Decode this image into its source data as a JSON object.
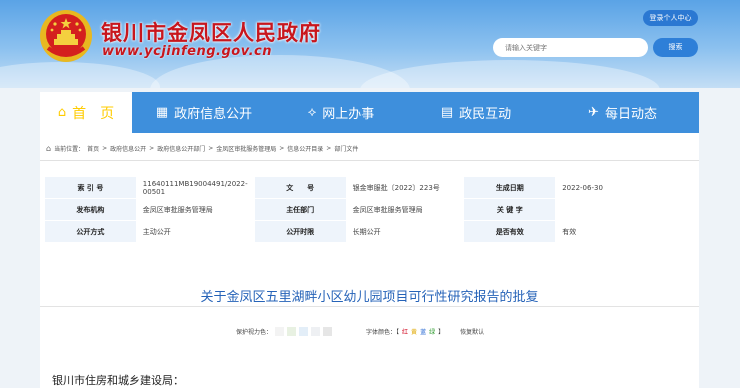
{
  "header": {
    "site_name": "银川市金凤区人民政府",
    "site_url": "www.ycjinfeng.gov.cn",
    "login_label": "登录个人中心",
    "search_placeholder": "请输入关键字",
    "search_button": "搜索"
  },
  "nav": {
    "items": [
      {
        "label": "首　页",
        "icon": "home-icon"
      },
      {
        "label": "政府信息公开",
        "icon": "building-icon"
      },
      {
        "label": "网上办事",
        "icon": "handshake-icon"
      },
      {
        "label": "政民互动",
        "icon": "chat-icon"
      },
      {
        "label": "每日动态",
        "icon": "megaphone-icon"
      }
    ]
  },
  "breadcrumb": {
    "prefix": "当前位置：",
    "items": [
      "首页",
      "政府信息公开",
      "政府信息公开部门",
      "金凤区审批服务管理局",
      "信息公开目录",
      "部门文件"
    ]
  },
  "meta": {
    "index_label": "索 引 号",
    "index_value": "11640111MB19004491/2022-00501",
    "doc_no_label": "文　　号",
    "doc_no_value": "银金审服批〔2022〕223号",
    "date_label": "生成日期",
    "date_value": "2022-06-30",
    "issuer_label": "发布机构",
    "issuer_value": "金凤区审批服务管理局",
    "theme_label": "主任部门",
    "theme_value": "金凤区审批服务管理局",
    "keyword_label": "关 键 字",
    "keyword_value": "",
    "mode_label": "公开方式",
    "mode_value": "主动公开",
    "period_label": "公开时限",
    "period_value": "长期公开",
    "valid_label": "是否有效",
    "valid_value": "有效"
  },
  "document": {
    "title": "关于金凤区五里湖畔小区幼儿园项目可行性研究报告的批复",
    "salutation": "银川市住房和城乡建设局："
  },
  "tools": {
    "eye_label": "保护视力色：",
    "font_color_label": "字体颜色：【",
    "red": "红",
    "yellow": "黄",
    "blue": "蓝",
    "green": "绿",
    "close_bracket": "】",
    "restore": "恢复默认",
    "swatches": [
      "#f3f3f3",
      "#e8f1e2",
      "#e3eef8",
      "#eef0f3",
      "#e6e6e6"
    ]
  },
  "colors": {
    "brand_red": "#c8161d",
    "nav_blue": "#3e8fdc",
    "title_blue": "#2663b8"
  }
}
